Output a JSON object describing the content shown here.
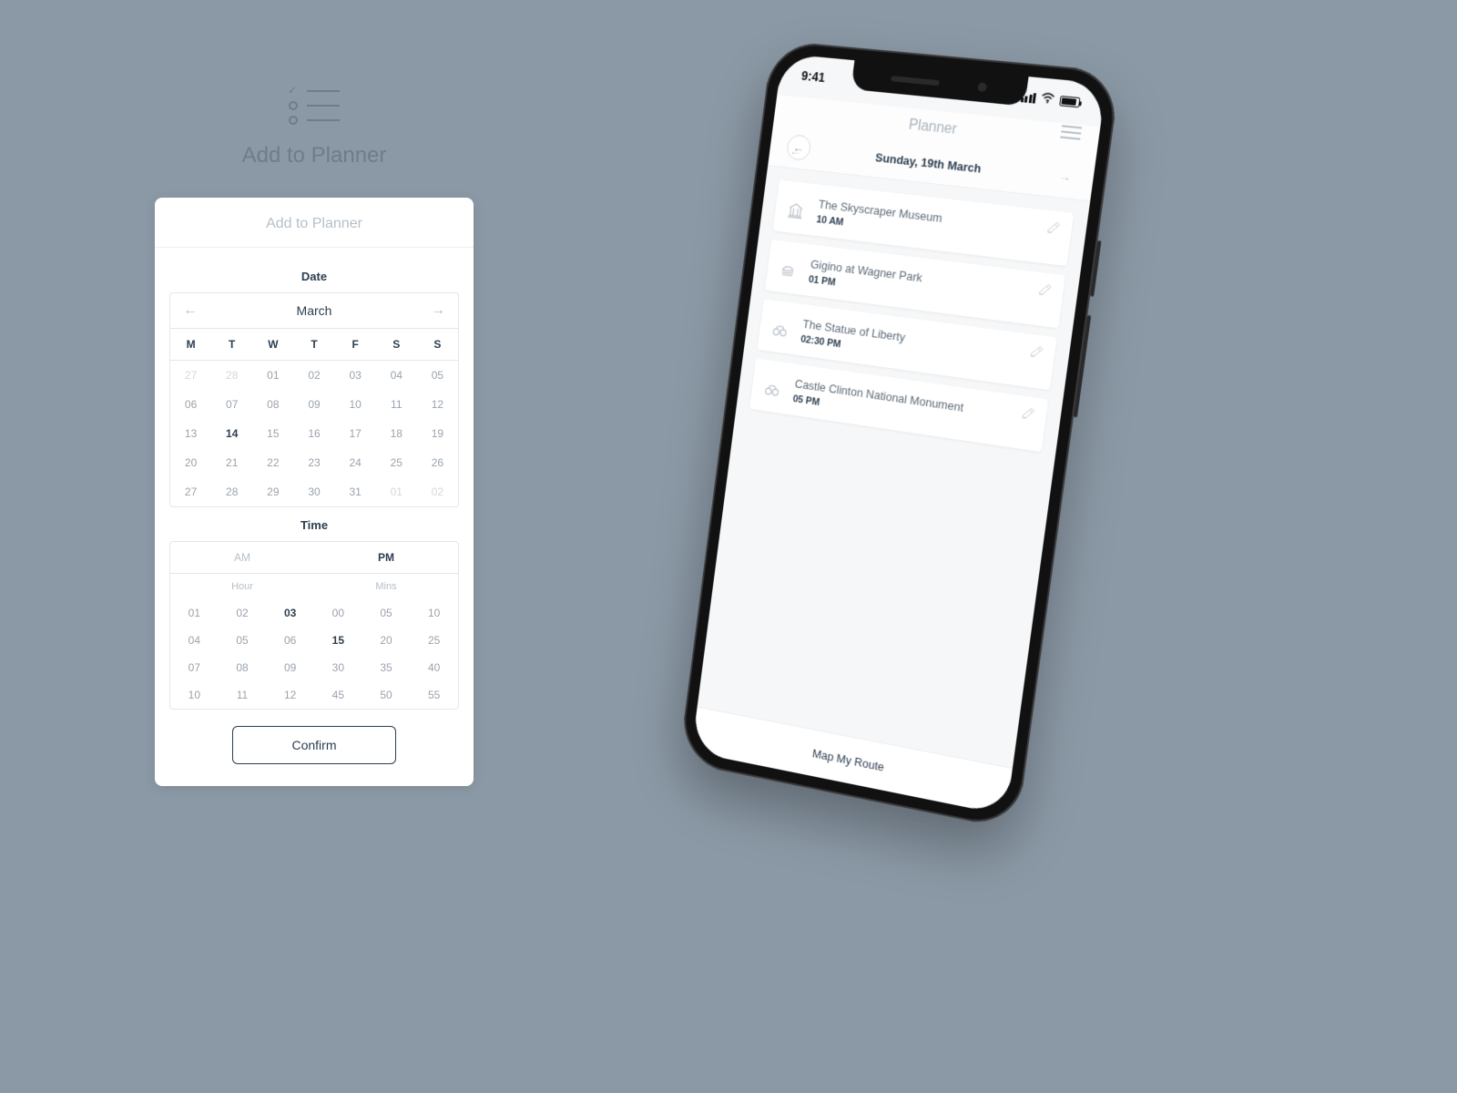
{
  "header": {
    "title": "Add to Planner"
  },
  "card": {
    "title": "Add to Planner",
    "date_label": "Date",
    "month": "March",
    "weekdays": [
      "M",
      "T",
      "W",
      "T",
      "F",
      "S",
      "S"
    ],
    "weeks": [
      [
        {
          "d": "27",
          "out": true
        },
        {
          "d": "28",
          "out": true
        },
        {
          "d": "01"
        },
        {
          "d": "02"
        },
        {
          "d": "03"
        },
        {
          "d": "04"
        },
        {
          "d": "05"
        }
      ],
      [
        {
          "d": "06"
        },
        {
          "d": "07"
        },
        {
          "d": "08"
        },
        {
          "d": "09"
        },
        {
          "d": "10"
        },
        {
          "d": "11"
        },
        {
          "d": "12"
        }
      ],
      [
        {
          "d": "13"
        },
        {
          "d": "14",
          "sel": true
        },
        {
          "d": "15"
        },
        {
          "d": "16"
        },
        {
          "d": "17"
        },
        {
          "d": "18"
        },
        {
          "d": "19"
        }
      ],
      [
        {
          "d": "20"
        },
        {
          "d": "21"
        },
        {
          "d": "22"
        },
        {
          "d": "23"
        },
        {
          "d": "24"
        },
        {
          "d": "25"
        },
        {
          "d": "26"
        }
      ],
      [
        {
          "d": "27"
        },
        {
          "d": "28"
        },
        {
          "d": "29"
        },
        {
          "d": "30"
        },
        {
          "d": "31"
        },
        {
          "d": "01",
          "out": true
        },
        {
          "d": "02",
          "out": true
        }
      ]
    ],
    "time_label": "Time",
    "am_label": "AM",
    "pm_label": "PM",
    "meridiem_selected": "PM",
    "hour_label": "Hour",
    "mins_label": "Mins",
    "hours": [
      "01",
      "02",
      "03",
      "04",
      "05",
      "06",
      "07",
      "08",
      "09",
      "10",
      "11",
      "12"
    ],
    "hour_selected": "03",
    "mins": [
      "00",
      "05",
      "10",
      "15",
      "20",
      "25",
      "30",
      "35",
      "40",
      "45",
      "50",
      "55"
    ],
    "min_selected": "15",
    "confirm_label": "Confirm"
  },
  "phone": {
    "status_time": "9:41",
    "app_title": "Planner",
    "date": "Sunday, 19th March",
    "items": [
      {
        "icon": "museum",
        "name": "The Skyscraper Museum",
        "time": "10 AM"
      },
      {
        "icon": "food",
        "name": "Gigino at Wagner Park",
        "time": "01 PM"
      },
      {
        "icon": "binoculars",
        "name": "The Statue of Liberty",
        "time": "02:30 PM"
      },
      {
        "icon": "binoculars",
        "name": "Castle Clinton National Monument",
        "time": "05 PM"
      }
    ],
    "map_route_label": "Map My Route"
  }
}
